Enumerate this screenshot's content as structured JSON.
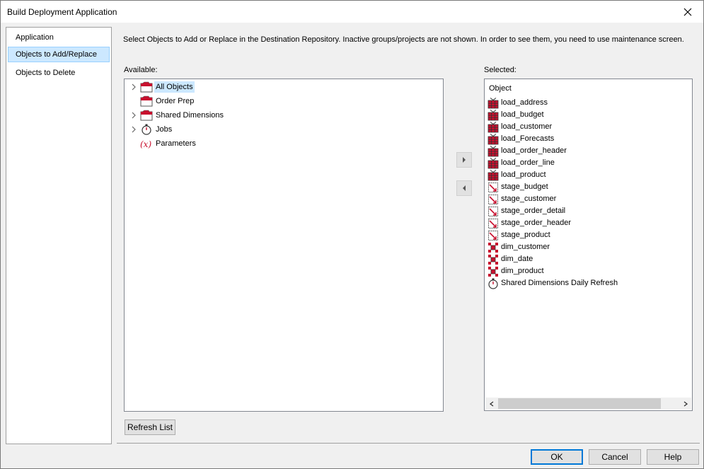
{
  "window": {
    "title": "Build Deployment Application"
  },
  "nav": {
    "items": [
      {
        "label": "Application",
        "selected": false
      },
      {
        "label": "Objects to Add/Replace",
        "selected": true
      },
      {
        "label": "Objects to Delete",
        "selected": false
      }
    ]
  },
  "description": "Select Objects to Add or Replace in the Destination Repository. Inactive groups/projects are not shown. In order to see them, you need to use maintenance screen.",
  "available": {
    "label": "Available:",
    "items": [
      {
        "label": "All Objects",
        "icon": "folder-icon",
        "expandable": true,
        "highlighted": true
      },
      {
        "label": "Order Prep",
        "icon": "folder-icon",
        "expandable": false,
        "highlighted": false
      },
      {
        "label": "Shared Dimensions",
        "icon": "folder-icon",
        "expandable": true,
        "highlighted": false
      },
      {
        "label": "Jobs",
        "icon": "stopwatch-icon",
        "expandable": true,
        "highlighted": false
      },
      {
        "label": "Parameters",
        "icon": "parameter-icon",
        "expandable": false,
        "highlighted": false
      }
    ]
  },
  "selected": {
    "label": "Selected:",
    "column_header": "Object",
    "items": [
      {
        "label": "load_address",
        "icon": "load-table-icon"
      },
      {
        "label": "load_budget",
        "icon": "load-table-icon"
      },
      {
        "label": "load_customer",
        "icon": "load-table-icon"
      },
      {
        "label": "load_Forecasts",
        "icon": "load-table-icon"
      },
      {
        "label": "load_order_header",
        "icon": "load-table-icon"
      },
      {
        "label": "load_order_line",
        "icon": "load-table-icon"
      },
      {
        "label": "load_product",
        "icon": "load-table-icon"
      },
      {
        "label": "stage_budget",
        "icon": "stage-table-icon"
      },
      {
        "label": "stage_customer",
        "icon": "stage-table-icon"
      },
      {
        "label": "stage_order_detail",
        "icon": "stage-table-icon"
      },
      {
        "label": "stage_order_header",
        "icon": "stage-table-icon"
      },
      {
        "label": "stage_product",
        "icon": "stage-table-icon"
      },
      {
        "label": "dim_customer",
        "icon": "dimension-table-icon"
      },
      {
        "label": "dim_date",
        "icon": "dimension-table-icon"
      },
      {
        "label": "dim_product",
        "icon": "dimension-table-icon"
      },
      {
        "label": "Shared Dimensions Daily Refresh",
        "icon": "stopwatch-icon"
      }
    ]
  },
  "buttons": {
    "refresh": "Refresh List",
    "ok": "OK",
    "cancel": "Cancel",
    "help": "Help"
  },
  "colors": {
    "selection": "#cce8ff",
    "icon_red": "#c8102e",
    "default_button_border": "#0078d7"
  }
}
